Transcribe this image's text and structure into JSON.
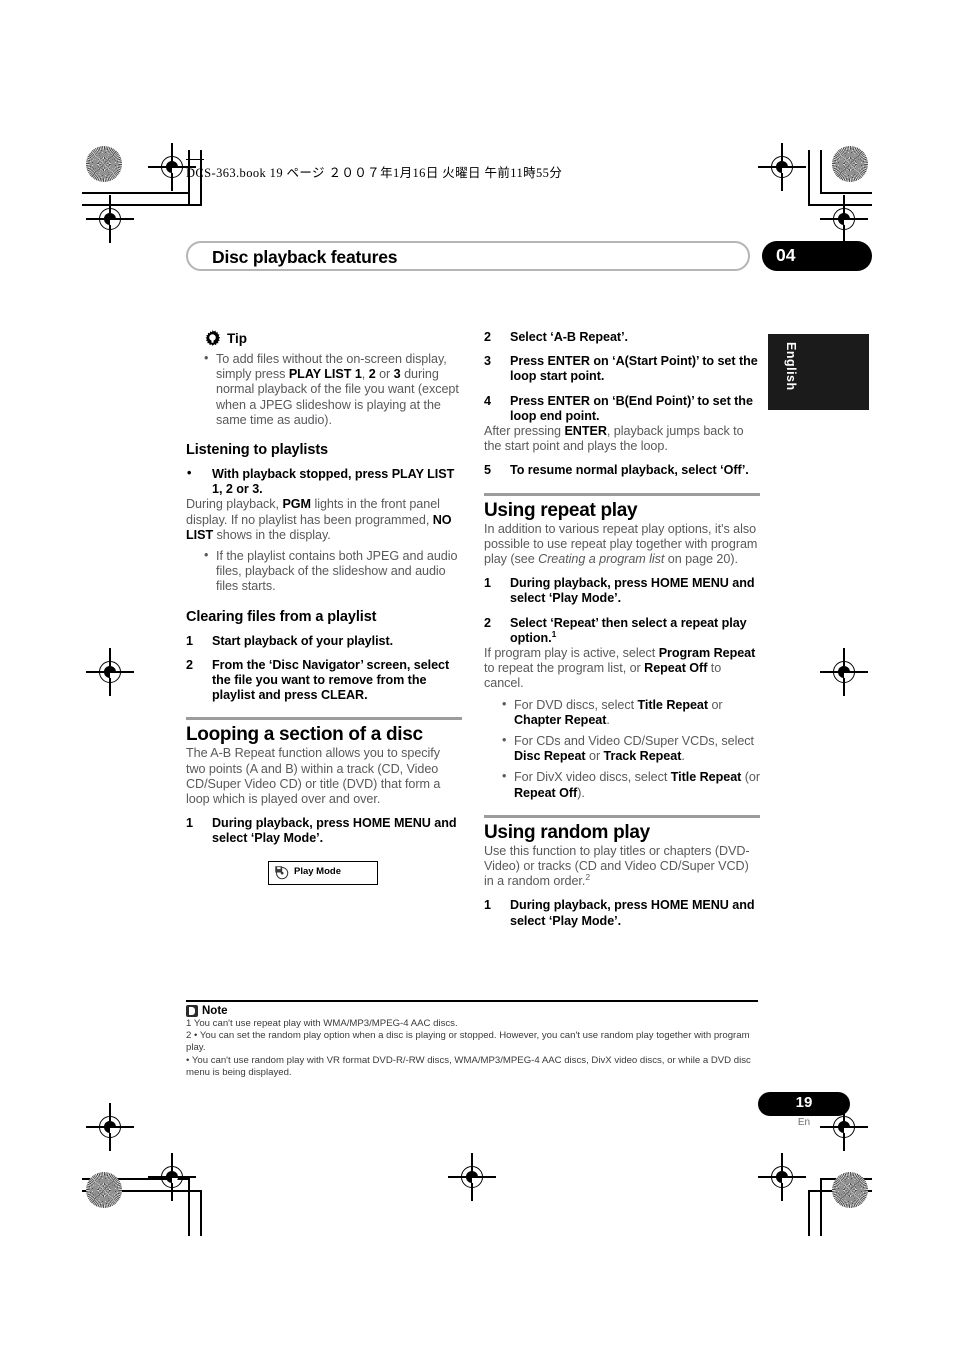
{
  "header": {
    "file_line": "DCS-363.book   19 ページ   ２００７年1月16日   火曜日   午前11時55分",
    "chapter_title": "Disc playback features",
    "chapter_number": "04",
    "language_tab": "English"
  },
  "left_column": {
    "tip": {
      "label": "Tip",
      "icon": "gear-tip-icon",
      "bullets": [
        {
          "parts": [
            {
              "t": "To add files without the on-screen display, simply press ",
              "b": false
            },
            {
              "t": "PLAY LIST 1",
              "b": true
            },
            {
              "t": ", ",
              "b": false
            },
            {
              "t": "2",
              "b": true
            },
            {
              "t": " or ",
              "b": false
            },
            {
              "t": "3",
              "b": true
            },
            {
              "t": " during normal playback of the file you want (except when a JPEG slideshow is playing at the same time as audio).",
              "b": false
            }
          ]
        }
      ]
    },
    "listening_heading": "Listening to playlists",
    "listening_step_bullet": "•",
    "listening_step_text": "With playback stopped, press PLAY LIST 1, 2 or 3.",
    "listening_body": [
      {
        "t": "During playback, ",
        "b": false
      },
      {
        "t": "PGM",
        "b": true
      },
      {
        "t": " lights in the front panel display. If no playlist has been programmed, ",
        "b": false
      },
      {
        "t": "NO LIST",
        "b": true
      },
      {
        "t": " shows in the display.",
        "b": false
      }
    ],
    "listening_bullet": "If the playlist contains both JPEG and audio files, playback of the slideshow and audio files starts.",
    "clearing_heading": "Clearing files from a playlist",
    "clearing_steps": [
      {
        "n": "1",
        "text": "Start playback of your playlist."
      },
      {
        "n": "2",
        "text": "From the ‘Disc Navigator’ screen, select the file you want to remove from the playlist and press CLEAR."
      }
    ],
    "looping_heading": "Looping a section of a disc",
    "looping_body": "The A-B Repeat function allows you to specify two points (A and B) within a track (CD, Video CD/Super Video CD) or title (DVD) that form a loop which is played over and over.",
    "looping_step1": {
      "n": "1",
      "text": "During playback, press HOME MENU and select ‘Play Mode’."
    },
    "play_mode_box": {
      "label": "Play Mode",
      "icon": "disc-play-mode-icon"
    }
  },
  "right_column": {
    "ab_steps": [
      {
        "n": "2",
        "text": "Select ‘A-B Repeat’."
      },
      {
        "n": "3",
        "text": "Press ENTER on ‘A(Start Point)’ to set the loop start point."
      },
      {
        "n": "4",
        "text": "Press ENTER on ‘B(End Point)’ to set the loop end point."
      }
    ],
    "ab_step4_body": [
      {
        "t": "After pressing ",
        "b": false
      },
      {
        "t": "ENTER",
        "b": true
      },
      {
        "t": ", playback jumps back to the start point and plays the loop.",
        "b": false
      }
    ],
    "ab_step5": {
      "n": "5",
      "text": "To resume normal playback, select ‘Off’."
    },
    "repeat_heading": "Using repeat play",
    "repeat_intro": [
      {
        "t": "In addition to various repeat play options, it's also possible to use repeat play together with program play (see ",
        "b": false,
        "i": false
      },
      {
        "t": "Creating a program list",
        "b": false,
        "i": true
      },
      {
        "t": " on page 20).",
        "b": false,
        "i": false
      }
    ],
    "repeat_step1": {
      "n": "1",
      "text": "During playback, press HOME MENU and select ‘Play Mode’."
    },
    "repeat_step2": {
      "n": "2",
      "text": "Select ‘Repeat’ then select a repeat play option.",
      "footnote": "1"
    },
    "repeat_step2_body": [
      {
        "t": "If program play is active, select ",
        "b": false
      },
      {
        "t": "Program Repeat",
        "b": true
      },
      {
        "t": " to repeat the program list, or ",
        "b": false
      },
      {
        "t": "Repeat Off",
        "b": true
      },
      {
        "t": " to cancel.",
        "b": false
      }
    ],
    "repeat_bullets": [
      [
        {
          "t": "For DVD discs, select ",
          "b": false
        },
        {
          "t": "Title Repeat",
          "b": true
        },
        {
          "t": " or ",
          "b": false
        },
        {
          "t": "Chapter Repeat",
          "b": true
        },
        {
          "t": ".",
          "b": false
        }
      ],
      [
        {
          "t": "For CDs and Video CD/Super VCDs, select ",
          "b": false
        },
        {
          "t": "Disc Repeat",
          "b": true
        },
        {
          "t": " or ",
          "b": false
        },
        {
          "t": "Track Repeat",
          "b": true
        },
        {
          "t": ".",
          "b": false
        }
      ],
      [
        {
          "t": "For DivX video discs, select ",
          "b": false
        },
        {
          "t": "Title Repeat",
          "b": true
        },
        {
          "t": " (or ",
          "b": false
        },
        {
          "t": "Repeat Off",
          "b": true
        },
        {
          "t": ").",
          "b": false
        }
      ]
    ],
    "random_heading": "Using random play",
    "random_intro": "Use this function to play titles or chapters (DVD-Video) or tracks (CD and Video CD/Super VCD) in a random order.",
    "random_intro_footnote": "2",
    "random_step1": {
      "n": "1",
      "text": "During playback, press HOME MENU and select ‘Play Mode’."
    }
  },
  "note": {
    "label": "Note",
    "icon": "note-icon",
    "lines": [
      {
        "text": "1 You can't use repeat play with WMA/MP3/MPEG-4 AAC discs.",
        "indent": false
      },
      {
        "text": "2 • You can set the random play option when a disc is playing or stopped. However, you can't use random play together with program play.",
        "indent": false
      },
      {
        "text": "• You can't use random play with VR format DVD-R/-RW discs, WMA/MP3/MPEG-4 AAC discs, DivX video discs, or while a DVD disc menu is being displayed.",
        "indent": true
      }
    ]
  },
  "footer": {
    "page_number": "19",
    "page_language": "En"
  },
  "colors": {
    "body_grey": "#58595b",
    "rule_grey": "#9c9c9c",
    "black": "#000000",
    "tab_black": "#1b1b1b"
  }
}
